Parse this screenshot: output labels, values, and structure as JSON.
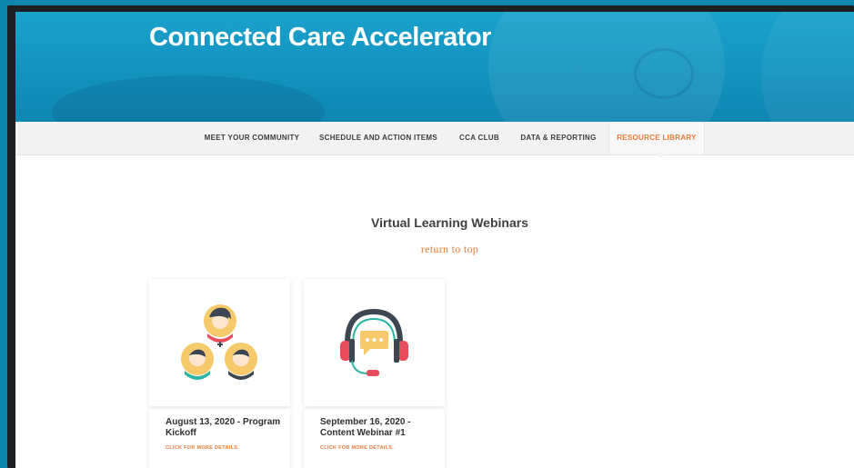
{
  "site": {
    "title": "Connected Care Accelerator"
  },
  "nav": {
    "items": [
      {
        "label": "MEET YOUR COMMUNITY"
      },
      {
        "label": "SCHEDULE AND ACTION ITEMS"
      },
      {
        "label": "CCA CLUB"
      },
      {
        "label": "DATA & REPORTING"
      },
      {
        "label": "RESOURCE LIBRARY",
        "active": true
      }
    ]
  },
  "section": {
    "title": "Virtual Learning Webinars",
    "return_link": "return to top"
  },
  "cards": [
    {
      "icon": "people-group-icon",
      "title": "August 13, 2020 - Program Kickoff",
      "link": "CLICK FOR MORE DETAILS."
    },
    {
      "icon": "headset-chat-icon",
      "title": "September 16, 2020 - Content Webinar #1",
      "link": "CLICK FOR MORE DETAILS."
    }
  ],
  "colors": {
    "brand_blue": "#1393bf",
    "accent_orange": "#e07b3a"
  }
}
